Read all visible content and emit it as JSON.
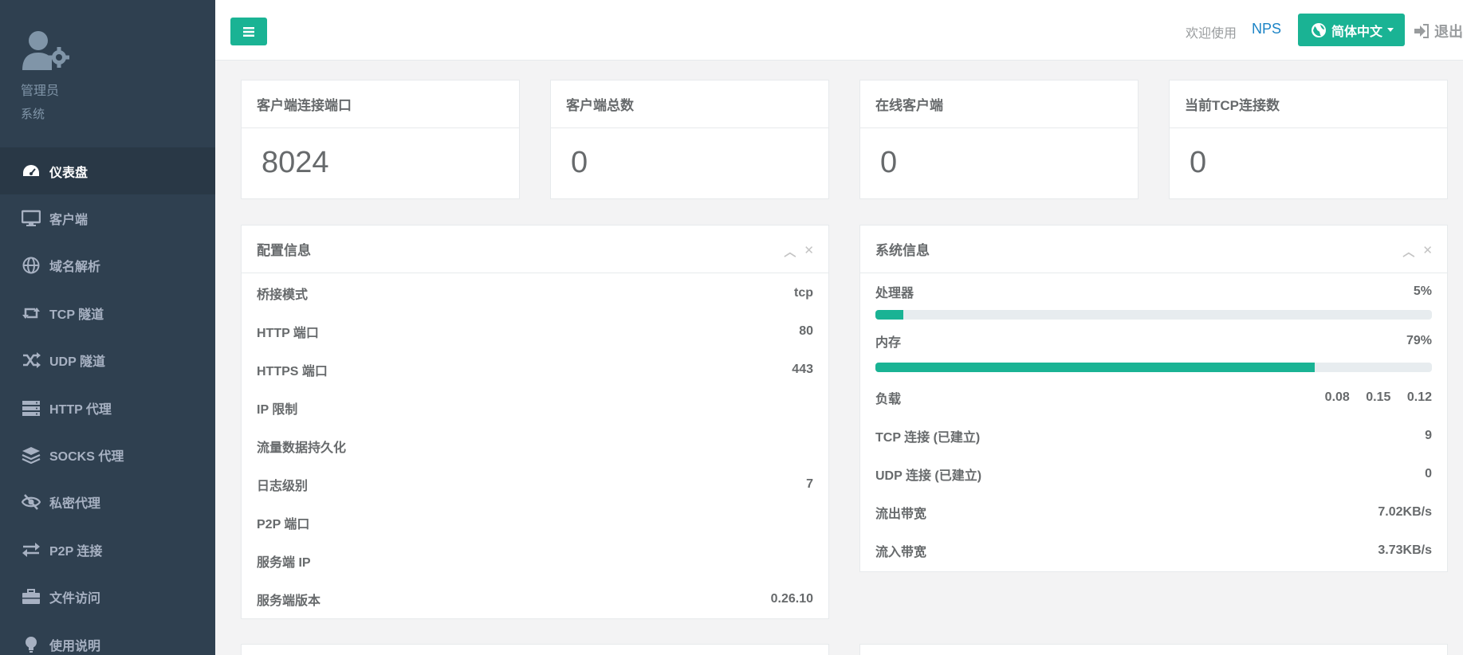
{
  "sidebar": {
    "profile": {
      "name": "管理员",
      "role": "系统"
    },
    "items": [
      {
        "label": "仪表盘",
        "icon": "dashboard-icon",
        "active": true
      },
      {
        "label": "客户端",
        "icon": "desktop-icon"
      },
      {
        "label": "域名解析",
        "icon": "globe-icon"
      },
      {
        "label": "TCP 隧道",
        "icon": "retweet-icon"
      },
      {
        "label": "UDP 隧道",
        "icon": "random-icon"
      },
      {
        "label": "HTTP 代理",
        "icon": "server-icon"
      },
      {
        "label": "SOCKS 代理",
        "icon": "layers-icon"
      },
      {
        "label": "私密代理",
        "icon": "eye-slash-icon"
      },
      {
        "label": "P2P 连接",
        "icon": "exchange-icon"
      },
      {
        "label": "文件访问",
        "icon": "briefcase-icon"
      },
      {
        "label": "使用说明",
        "icon": "lightbulb-icon"
      }
    ]
  },
  "header": {
    "welcome": "欢迎使用",
    "brand": "NPS",
    "language": "简体中文",
    "logout": "退出"
  },
  "stats": [
    {
      "title": "客户端连接端口",
      "value": "8024"
    },
    {
      "title": "客户端总数",
      "value": "0"
    },
    {
      "title": "在线客户端",
      "value": "0"
    },
    {
      "title": "当前TCP连接数",
      "value": "0"
    }
  ],
  "config": {
    "title": "配置信息",
    "rows": [
      {
        "label": "桥接模式",
        "value": "tcp"
      },
      {
        "label": "HTTP 端口",
        "value": "80"
      },
      {
        "label": "HTTPS 端口",
        "value": "443"
      },
      {
        "label": "IP 限制",
        "value": ""
      },
      {
        "label": "流量数据持久化",
        "value": ""
      },
      {
        "label": "日志级别",
        "value": "7"
      },
      {
        "label": "P2P 端口",
        "value": ""
      },
      {
        "label": "服务端 IP",
        "value": ""
      },
      {
        "label": "服务端版本",
        "value": "0.26.10"
      }
    ]
  },
  "system": {
    "title": "系统信息",
    "cpu": {
      "label": "处理器",
      "value": "5%",
      "percent": 5
    },
    "mem": {
      "label": "内存",
      "value": "79%",
      "percent": 79
    },
    "load": {
      "label": "负载",
      "values": [
        "0.08",
        "0.15",
        "0.12"
      ]
    },
    "rows": [
      {
        "label": "TCP 连接 (已建立)",
        "value": "9"
      },
      {
        "label": "UDP 连接 (已建立)",
        "value": "0"
      },
      {
        "label": "流出带宽",
        "value": "7.02KB/s"
      },
      {
        "label": "流入带宽",
        "value": "3.73KB/s"
      }
    ]
  },
  "colors": {
    "accent": "#1ab394",
    "sidebar": "#2f4050",
    "link": "#1c84c6"
  }
}
